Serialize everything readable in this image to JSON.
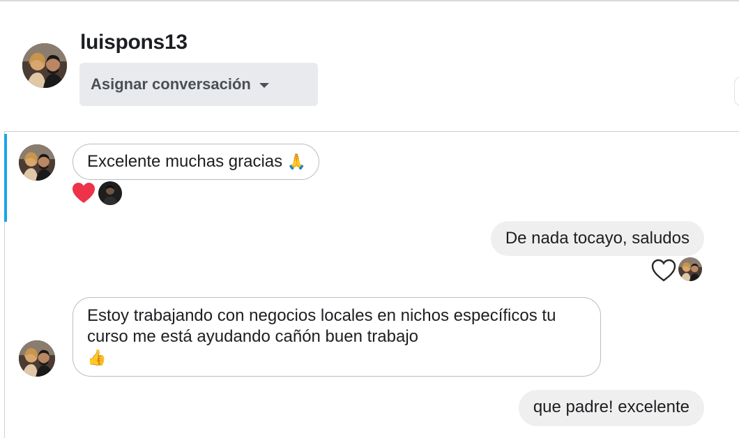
{
  "header": {
    "username": "luispons13",
    "assign_label": "Asignar conversación"
  },
  "messages": [
    {
      "direction": "incoming",
      "text": "Excelente muchas gracias",
      "emoji": "🙏",
      "reactions": [
        "heart-filled",
        "avatar"
      ]
    },
    {
      "direction": "outgoing",
      "text": "De nada tocayo, saludos",
      "reactions": [
        "heart-outline",
        "avatar"
      ]
    },
    {
      "direction": "incoming",
      "text": "Estoy trabajando con negocios locales en nichos específicos tu curso me está ayudando cañón buen trabajo",
      "emoji": "👍"
    },
    {
      "direction": "outgoing",
      "text": "que padre! excelente"
    }
  ],
  "colors": {
    "accent": "#1aa3e8",
    "heart": "#ed3349",
    "outgoing_bubble": "#efefef",
    "assign_button_bg": "#e8eaed"
  }
}
